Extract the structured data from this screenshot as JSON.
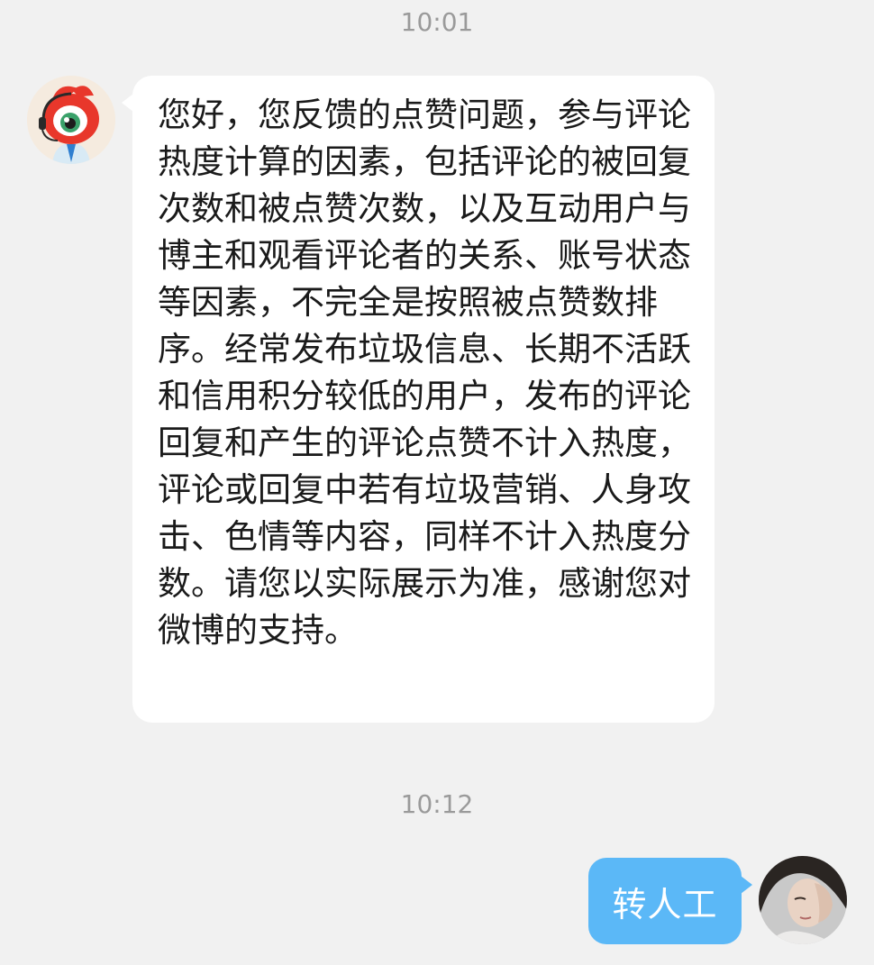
{
  "messages": [
    {
      "timestamp": "10:01",
      "sender": "bot",
      "avatar_icon": "weibo-mascot-avatar",
      "text": "您好，您反馈的点赞问题，参与评论热度计算的因素，包括评论的被回复次数和被点赞次数，以及互动用户与博主和观看评论者的关系、账号状态等因素，不完全是按照被点赞数排序。经常发布垃圾信息、长期不活跃和信用积分较低的用户，发布的评论回复和产生的评论点赞不计入热度，评论或回复中若有垃圾营销、人身攻击、色情等内容，同样不计入热度分数。请您以实际展示为准，感谢您对微博的支持。"
    },
    {
      "timestamp": "10:12",
      "sender": "user",
      "avatar_icon": "user-photo-avatar",
      "text": "转人工"
    }
  ],
  "colors": {
    "background": "#f1f1f1",
    "incoming_bubble": "#ffffff",
    "outgoing_bubble": "#5bb8f7",
    "timestamp_text": "#9a9a9a"
  }
}
